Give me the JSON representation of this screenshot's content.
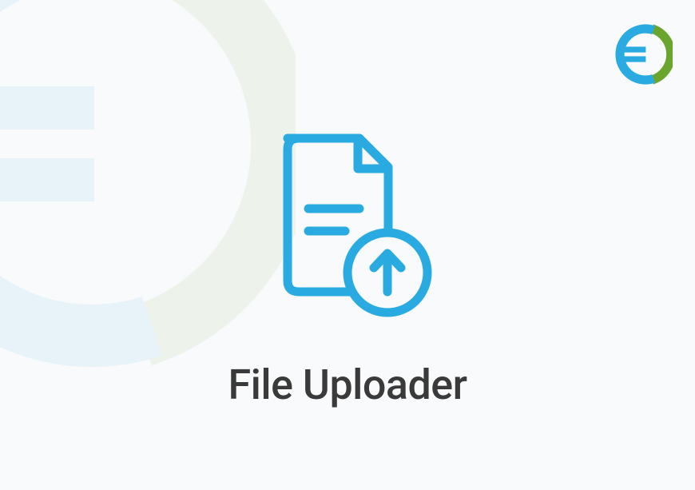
{
  "title": "File Uploader",
  "colors": {
    "accent_blue": "#29abe2",
    "accent_green": "#6aa62e",
    "text_dark": "#3a3a3a"
  },
  "icons": {
    "main": "file-upload-icon",
    "logo": "company-logo-icon"
  }
}
